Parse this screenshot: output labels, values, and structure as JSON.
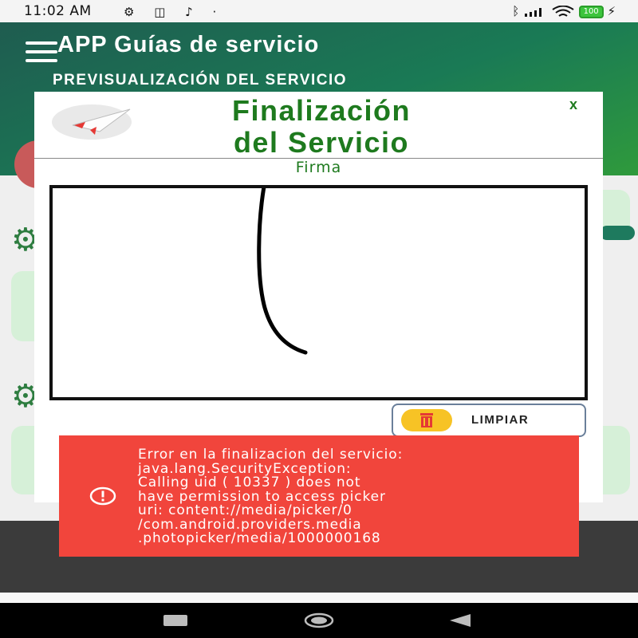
{
  "status_bar": {
    "time": "11:02 AM",
    "left_icons": [
      "settings-icon",
      "media-icon",
      "music-icon",
      "dot-icon"
    ],
    "battery": "100"
  },
  "app": {
    "title": "APP Guías de servicio",
    "subtitle": "PREVISUALIZACIÓN DEL SERVICIO"
  },
  "dialog": {
    "title_line1": "Finalización",
    "title_line2": "del Servicio",
    "close_label": "x",
    "signature_label": "Firma",
    "clear_button_label": "LIMPIAR"
  },
  "toast": {
    "message": "Error en la finalizacion del servicio:\njava.lang.SecurityException:\nCalling uid ( 10337 ) does not\nhave permission to access picker\nuri: content://media/picker/0\n/com.android.providers.media\n.photopicker/media/1000000168"
  },
  "colors": {
    "brand_green": "#1e7a1e",
    "toast_red": "#f1453c",
    "appbar_start": "#1f5c50",
    "appbar_end": "#2f9a3c"
  }
}
